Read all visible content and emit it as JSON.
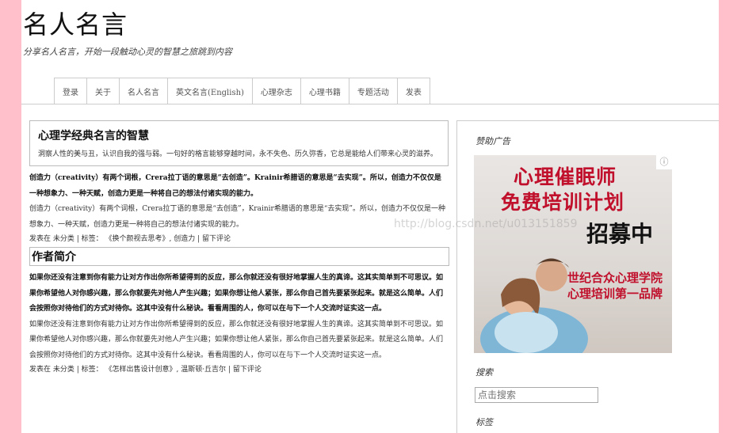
{
  "site": {
    "title": "名人名言",
    "tagline": "分享名人名言，开始一段触动心灵的智慧之旅跳到内容"
  },
  "nav": [
    "登录",
    "关于",
    "名人名言",
    "英文名言(English)",
    "心理杂志",
    "心理书籍",
    "专题活动",
    "发表"
  ],
  "intro": {
    "title": "心理学经典名言的智慧",
    "text": "洞察人性的美与丑，认识自我的强与弱。一句好的格言能够穿越时间，永不失色、历久弥香，它总是能给人们带来心灵的滋养。"
  },
  "post1": {
    "bold_text": "创造力（creativity）有两个词根，Crera拉丁语的意思是“去创造”。Krainir希腊语的意思是“去实现”。所以，创造力不仅仅是一种想象力、一种天赋，创造力更是一种将自己的想法付诸实现的能力。",
    "text": "创造力（creativity）有两个词根，Crera拉丁语的意思是“去创造”，Krainir希腊语的意思是“去实现”。所以，创造力不仅仅是一种想象力、一种天赋，创造力更是一种将自己的想法付诸实现的能力。",
    "meta": "发表在 未分类 | 标签： 《换个颜视去思考》, 创造力 | 留下评论"
  },
  "author_heading": "作者简介",
  "post2": {
    "bold_text": "如果你还没有注意到你有能力让对方作出你所希望得到的反应，那么你就还没有很好地掌握人生的真谛。这其实简单到不可思议。如果你希望他人对你感兴趣，那么你就要先对他人产生兴趣；如果你想让他人紧张，那么你自己首先要紧张起来。就是这么简单。人们会按照你对待他们的方式对待你。这其中没有什么秘诀。看看周围的人，你可以在与下一个人交流时证实这一点。",
    "text": "如果你还没有注意到你有能力让对方作出你所希望得到的反应，那么你就还没有很好地掌握人生的真谛。这其实简单到不可思议。如果你希望他人对你感兴趣，那么你就要先对他人产生兴趣；如果你想让他人紧张，那么你自己首先要紧张起来。就是这么简单。人们会按照你对待他们的方式对待你。这其中没有什么秘诀。看看周围的人，你可以在与下一个人交流时证实这一点。",
    "meta": "发表在 未分类 | 标签： 《怎样出售设计创意》, 温斯顿·丘吉尔 | 留下评论"
  },
  "sidebar": {
    "ad_title": "赞助广告",
    "ad": {
      "line1": "心理催眠师",
      "line2": "免费培训计划",
      "line3": "招募中",
      "line4": "世纪合众心理学院",
      "line5": "心理培训第一品牌"
    },
    "search_title": "搜索",
    "search_placeholder": "点击搜索",
    "tags_title": "标签"
  },
  "watermark": "http://blog.csdn.net/u013151859"
}
